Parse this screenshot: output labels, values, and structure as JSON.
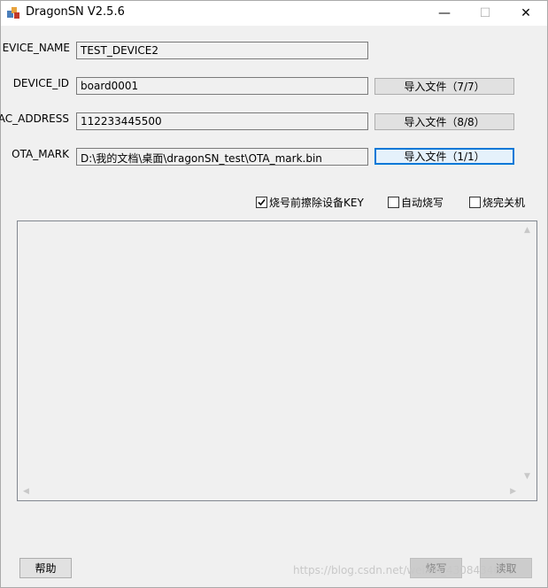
{
  "window": {
    "title": "DragonSN V2.5.6",
    "controls": {
      "minimize": "—",
      "maximize": "☐",
      "close": "✕"
    },
    "icon": "app-icon"
  },
  "fields": {
    "device_name": {
      "label": "EVICE_NAME",
      "value": "TEST_DEVICE2"
    },
    "device_id": {
      "label": "DEVICE_ID",
      "value": "board0001",
      "import_label": "导入文件（7/7）"
    },
    "mac_address": {
      "label": "AC_ADDRESS",
      "value": "112233445500",
      "import_label": "导入文件（8/8）"
    },
    "ota_mark": {
      "label": "OTA_MARK",
      "value": "D:\\我的文档\\桌面\\dragonSN_test\\OTA_mark.bin",
      "import_label": "导入文件（1/1）"
    }
  },
  "options": {
    "erase_key": {
      "label": "烧号前擦除设备KEY",
      "checked": true
    },
    "auto_burn": {
      "label": "自动烧写",
      "checked": false
    },
    "shutdown": {
      "label": "烧完关机",
      "checked": false
    }
  },
  "footer": {
    "help_label": "帮助",
    "burn_label": "烧写",
    "read_label": "读取"
  },
  "watermark": "https://blog.csdn.net/weixin_43084346",
  "colors": {
    "focus_border": "#0078d7",
    "button_bg": "#e1e1e1"
  }
}
